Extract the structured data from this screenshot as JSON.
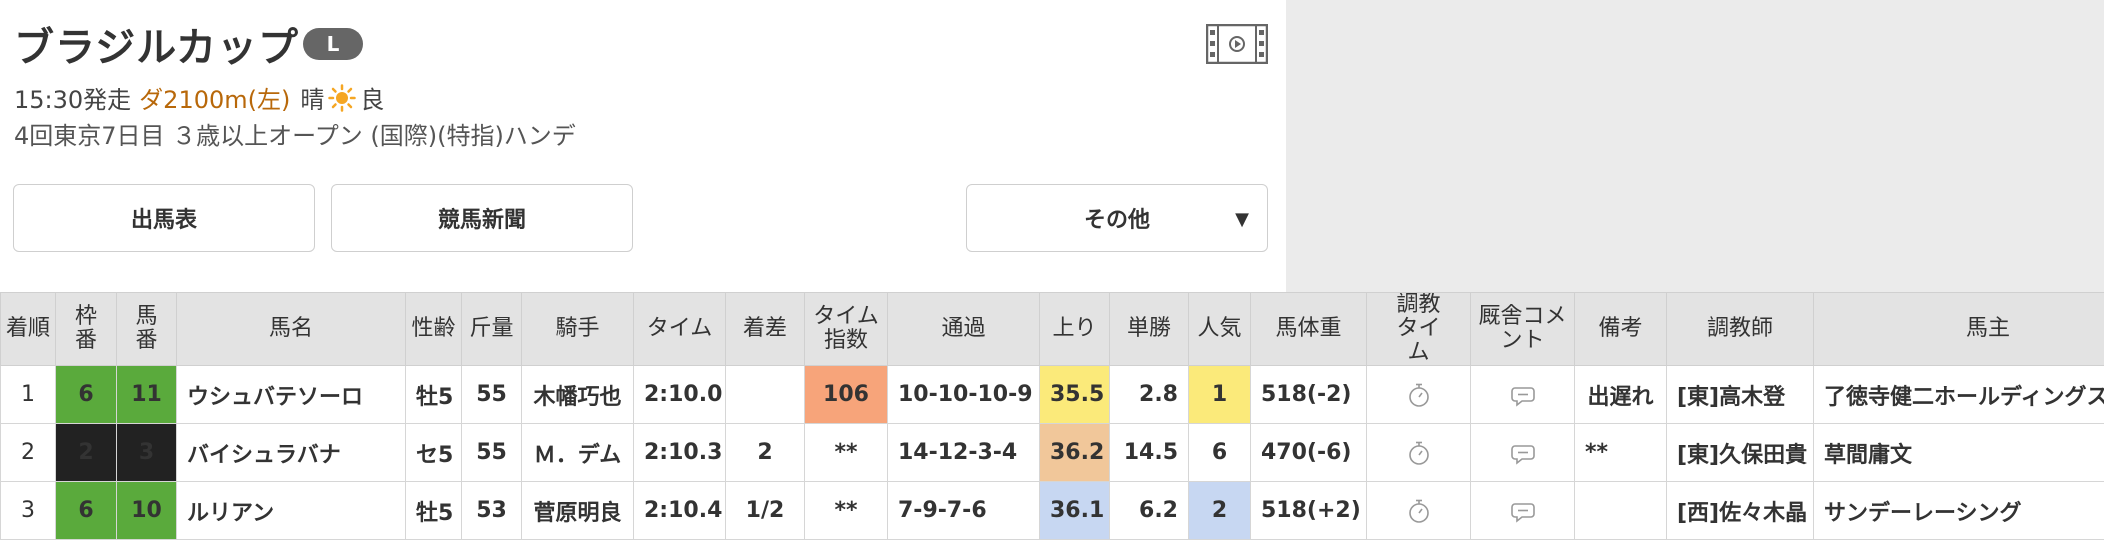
{
  "race": {
    "name": "ブラジルカップ",
    "grade": "L",
    "start": "15:30発走",
    "course": "ダ2100m(左)",
    "weather": "晴",
    "condition": "良",
    "meeting_info": "4回東京7日目 ３歳以上オープン (国際)(特指)ハンデ"
  },
  "buttons": {
    "card": "出馬表",
    "newspaper": "競馬新聞",
    "other": "その他",
    "other_caret": "▼"
  },
  "icons": {
    "video": "video-icon",
    "sun": "sun-icon",
    "stopwatch": "stopwatch-icon",
    "comment": "comment-icon"
  },
  "colors": {
    "waku_6": "#5aaa3c",
    "waku_2": "#222222",
    "index_high": "#f7a47a",
    "agari_1": "#fbea7a",
    "agari_2": "#f1c79a",
    "agari_3": "#c7d7f2",
    "pop_1": "#fbea7a",
    "pop_2": "#c7d7f2",
    "link": "#1a3c8c"
  },
  "table": {
    "headers": {
      "rank": "着順",
      "waku": "枠番",
      "umaban": "馬番",
      "horse": "馬名",
      "sexage": "性齢",
      "weight": "斤量",
      "jockey": "騎手",
      "time": "タイム",
      "margin": "着差",
      "index": "タイム指数",
      "passing": "通過",
      "agari": "上り",
      "odds": "単勝",
      "pop": "人気",
      "bodyweight": "馬体重",
      "training": "調教タイム",
      "comment": "厩舎コメント",
      "note": "備考",
      "trainer": "調教師",
      "owner": "馬主"
    },
    "rows": [
      {
        "rank": "1",
        "waku": "6",
        "umaban": "11",
        "horse": "ウシュバテソーロ",
        "sexage": "牡5",
        "weight": "55",
        "jockey": "木幡巧也",
        "time": "2:10.0",
        "margin": "",
        "index": "106",
        "passing": "10-10-10-9",
        "agari": "35.5",
        "odds": "2.8",
        "pop": "1",
        "bodyweight": "518(-2)",
        "note": "出遅れ",
        "trainer": "[東]高木登",
        "owner": "了徳寺健二ホールディングス"
      },
      {
        "rank": "2",
        "waku": "2",
        "umaban": "3",
        "horse": "バイシュラバナ",
        "sexage": "セ5",
        "weight": "55",
        "jockey": "Ｍ．デム",
        "time": "2:10.3",
        "margin": "2",
        "index": "**",
        "passing": "14-12-3-4",
        "agari": "36.2",
        "odds": "14.5",
        "pop": "6",
        "bodyweight": "470(-6)",
        "note": "**",
        "trainer": "[東]久保田貴",
        "owner": "草間庸文"
      },
      {
        "rank": "3",
        "waku": "6",
        "umaban": "10",
        "horse": "ルリアン",
        "sexage": "牡5",
        "weight": "53",
        "jockey": "菅原明良",
        "time": "2:10.4",
        "margin": "1/2",
        "index": "**",
        "passing": "7-9-7-6",
        "agari": "36.1",
        "odds": "6.2",
        "pop": "2",
        "bodyweight": "518(+2)",
        "note": "",
        "trainer": "[西]佐々木晶",
        "owner": "サンデーレーシング"
      }
    ]
  }
}
